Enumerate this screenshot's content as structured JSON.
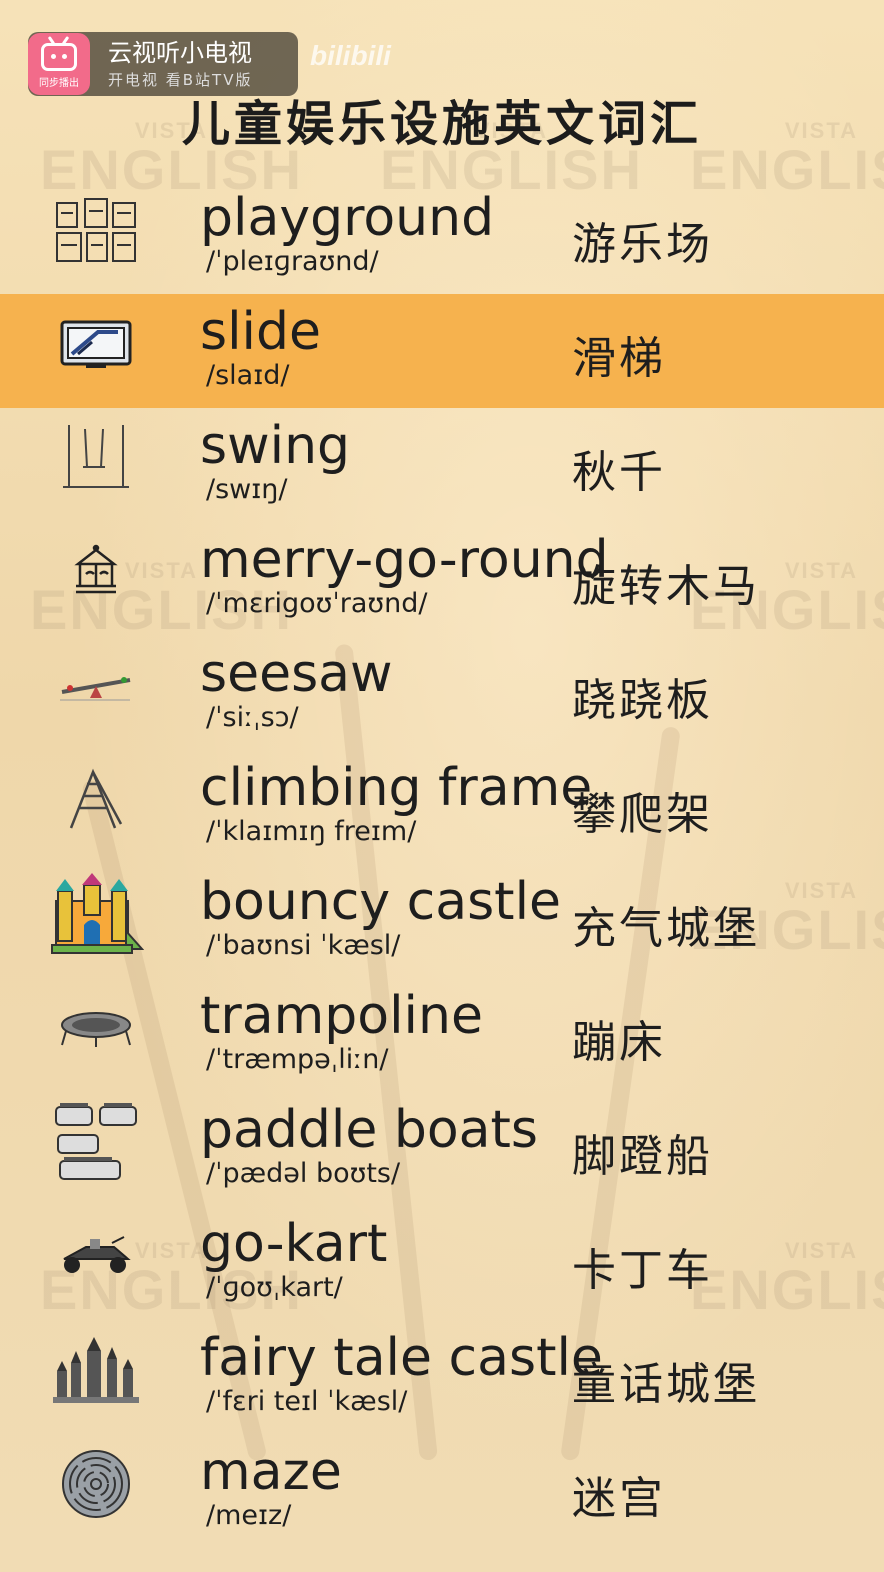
{
  "overlay": {
    "app_name": "云视听小电视",
    "app_sub": "开电视 看B站TV版",
    "sync_badge": "同步播出"
  },
  "watermark": {
    "brand": "bilibili",
    "vista": "VISTA",
    "english": "ENGLISH"
  },
  "title": "儿童娱乐设施英文词汇",
  "items": [
    {
      "icon": "playground-icon",
      "word": "playground",
      "phonetic": "/ˈpleɪɡraʊnd/",
      "cn": "游乐场"
    },
    {
      "icon": "slide-icon",
      "word": "slide",
      "phonetic": "/slaɪd/",
      "cn": "滑梯"
    },
    {
      "icon": "swing-icon",
      "word": "swing",
      "phonetic": "/swɪŋ/",
      "cn": "秋千"
    },
    {
      "icon": "carousel-icon",
      "word": "merry-go-round",
      "phonetic": "/ˈmɛrigoʊˈraʊnd/",
      "cn": "旋转木马"
    },
    {
      "icon": "seesaw-icon",
      "word": "seesaw",
      "phonetic": "/ˈsiːˌsɔ/",
      "cn": "跷跷板"
    },
    {
      "icon": "climbing-frame-icon",
      "word": "climbing frame",
      "phonetic": "/ˈklaɪmɪŋ freɪm/",
      "cn": "攀爬架"
    },
    {
      "icon": "bouncy-castle-icon",
      "word": "bouncy castle",
      "phonetic": "/ˈbaʊnsi ˈkæsl/",
      "cn": "充气城堡"
    },
    {
      "icon": "trampoline-icon",
      "word": "trampoline",
      "phonetic": "/ˈtræmpəˌliːn/",
      "cn": "蹦床"
    },
    {
      "icon": "paddle-boat-icon",
      "word": "paddle boats",
      "phonetic": "/ˈpædəl boʊts/",
      "cn": "脚蹬船"
    },
    {
      "icon": "go-kart-icon",
      "word": "go-kart",
      "phonetic": "/ˈɡoʊˌkart/",
      "cn": "卡丁车"
    },
    {
      "icon": "fairy-castle-icon",
      "word": "fairy tale castle",
      "phonetic": "/ˈfɛri teɪl ˈkæsl/",
      "cn": "童话城堡"
    },
    {
      "icon": "maze-icon",
      "word": "maze",
      "phonetic": "/meɪz/",
      "cn": "迷宫"
    }
  ],
  "colors": {
    "highlight": "#f6b24e",
    "background": "#f3dcb0",
    "text": "#1e1e1e"
  }
}
